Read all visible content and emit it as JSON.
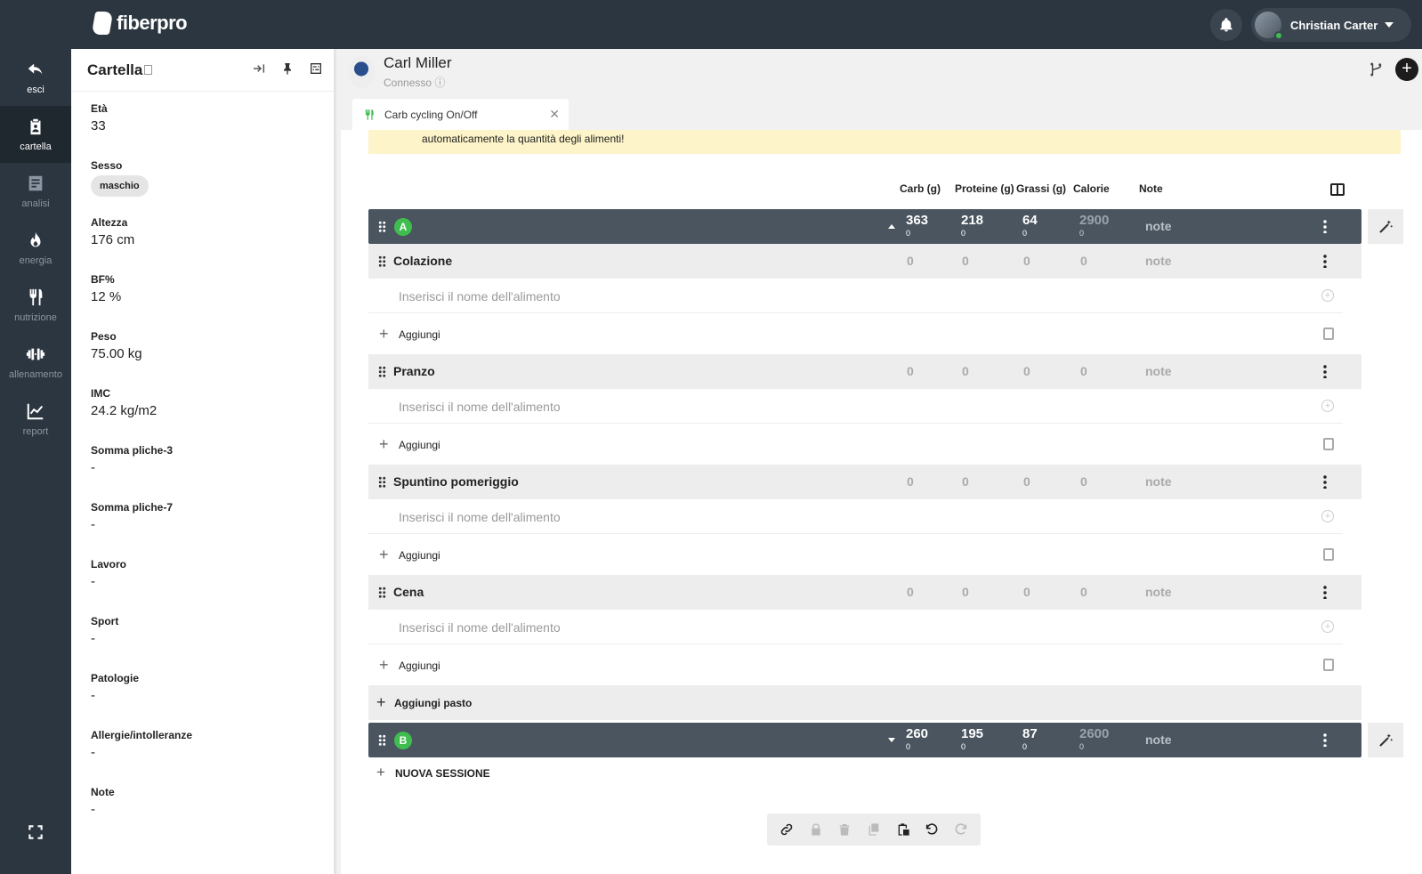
{
  "brand": {
    "name": "fiberpro"
  },
  "user": {
    "name": "Christian Carter"
  },
  "nav": [
    {
      "label": "esci",
      "icon": "undo-arrow-icon"
    },
    {
      "label": "cartella",
      "icon": "clipboard-icon"
    },
    {
      "label": "analisi",
      "icon": "document-icon"
    },
    {
      "label": "energia",
      "icon": "flame-icon"
    },
    {
      "label": "nutrizione",
      "icon": "cutlery-icon"
    },
    {
      "label": "allenamento",
      "icon": "dumbbell-icon"
    },
    {
      "label": "report",
      "icon": "chart-line-icon"
    }
  ],
  "cartella": {
    "title": "Cartella",
    "fields": [
      {
        "label": "Età",
        "value": "33"
      },
      {
        "label": "Sesso",
        "value": "maschio"
      },
      {
        "label": "Altezza",
        "value": "176 cm"
      },
      {
        "label": "BF%",
        "value": "12 %"
      },
      {
        "label": "Peso",
        "value": "75.00 kg"
      },
      {
        "label": "IMC",
        "value": "24.2 kg/m2"
      },
      {
        "label": "Somma pliche-3",
        "value": "-"
      },
      {
        "label": "Somma pliche-7",
        "value": "-"
      },
      {
        "label": "Lavoro",
        "value": "-"
      },
      {
        "label": "Sport",
        "value": "-"
      },
      {
        "label": "Patologie",
        "value": "-"
      },
      {
        "label": "Allergie/intolleranze",
        "value": "-"
      },
      {
        "label": "Note",
        "value": "-"
      }
    ]
  },
  "patient": {
    "name": "Carl Miller",
    "status": "Connesso ⓘ"
  },
  "tab": {
    "label": "Carb cycling On/Off",
    "close": "✕"
  },
  "notice": "automaticamente la quantità degli alimenti!",
  "columns": {
    "carb": "Carb (g)",
    "protein": "Proteine (g)",
    "fat": "Grassi (g)",
    "calories": "Calorie",
    "note": "Note"
  },
  "sessions": [
    {
      "badge": "A",
      "carb": "363",
      "carb_sub": "0",
      "protein": "218",
      "protein_sub": "0",
      "fat": "64",
      "fat_sub": "0",
      "calories": "2900",
      "calories_sub": "0",
      "note": "note"
    },
    {
      "badge": "B",
      "carb": "260",
      "carb_sub": "0",
      "protein": "195",
      "protein_sub": "0",
      "fat": "87",
      "fat_sub": "0",
      "calories": "2600",
      "calories_sub": "0",
      "note": "note"
    }
  ],
  "meals": [
    {
      "name": "Colazione",
      "carb": "0",
      "protein": "0",
      "fat": "0",
      "calories": "0",
      "note": "note"
    },
    {
      "name": "Pranzo",
      "carb": "0",
      "protein": "0",
      "fat": "0",
      "calories": "0",
      "note": "note"
    },
    {
      "name": "Spuntino pomeriggio",
      "carb": "0",
      "protein": "0",
      "fat": "0",
      "calories": "0",
      "note": "note"
    },
    {
      "name": "Cena",
      "carb": "0",
      "protein": "0",
      "fat": "0",
      "calories": "0",
      "note": "note"
    }
  ],
  "food_placeholder": "Inserisci il nome dell'alimento",
  "add_label": "Aggiungi",
  "add_meal_label": "Aggiungi pasto",
  "new_session_label": "NUOVA SESSIONE",
  "colors": {
    "topbar": "#2c3640",
    "session_bar": "#4a5560",
    "badge_green": "#3fbd4f",
    "notice_bg": "#fdf4c9"
  }
}
